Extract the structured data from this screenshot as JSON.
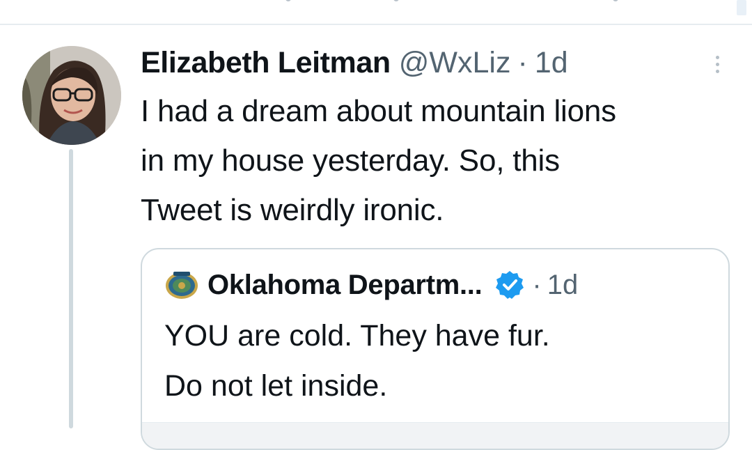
{
  "tweet": {
    "author": {
      "display_name": "Elizabeth Leitman",
      "handle": "@WxLiz"
    },
    "separator": "·",
    "timestamp": "1d",
    "text_lines": [
      "I had a dream about mountain lions",
      "in my house yesterday. So, this",
      "Tweet is weirdly ironic."
    ],
    "more_icon": "more-vertical-icon"
  },
  "quote": {
    "author": {
      "display_name": "Oklahoma Departm...",
      "verified": true,
      "verified_color": "#1d9bf0"
    },
    "separator": "·",
    "timestamp": "1d",
    "text_lines": [
      "YOU are cold. They have fur.",
      "Do not let inside."
    ]
  },
  "colors": {
    "text_primary": "#0f1419",
    "text_secondary": "#536471",
    "border": "#cfd9de",
    "accent": "#1d9bf0"
  }
}
